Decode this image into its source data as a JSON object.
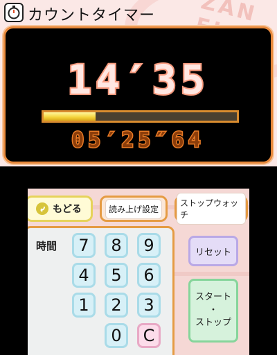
{
  "app": {
    "title": "カウントタイマー",
    "title_icon": "stopwatch-icon"
  },
  "display": {
    "main_time": "14′35",
    "sub_time": "05′25″64",
    "progress": 0.27
  },
  "toolbar": {
    "back_label": "もどる",
    "readout_label": "読み上げ設定",
    "stopwatch_label": "ストップウォッチ"
  },
  "keypad": {
    "unit_label": "時間",
    "keys": [
      "7",
      "8",
      "9",
      "4",
      "5",
      "6",
      "1",
      "2",
      "3",
      "0",
      "C"
    ]
  },
  "controls": {
    "reset_label": "リセット",
    "start_label": "スタート",
    "dot": "・",
    "stop_label": "ストップ"
  },
  "background_text": "ZAN FI",
  "colors": {
    "accent_orange": "#e59b43",
    "display_digits": "#f59a7f",
    "progress_fill": "#f3d23a",
    "key_blue": "#d7f0f7",
    "clear_pink": "#fcdcea",
    "reset_purple": "#e4dcf7",
    "start_green": "#d6f2dc"
  }
}
